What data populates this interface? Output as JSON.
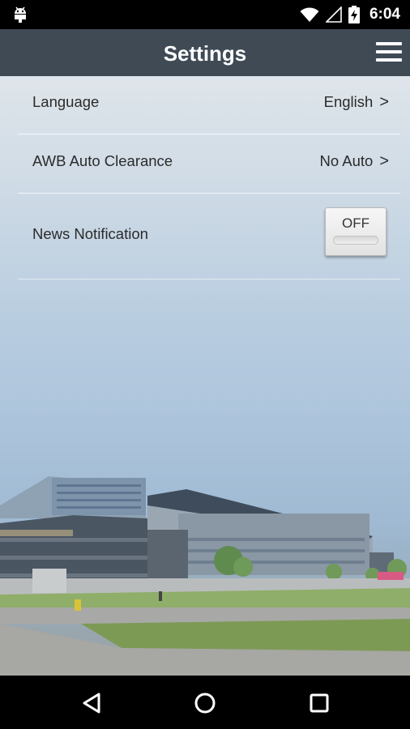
{
  "status_bar": {
    "time": "6:04",
    "icons": [
      "android-icon",
      "wifi-icon",
      "cellular-signal-icon",
      "battery-charging-icon"
    ]
  },
  "header": {
    "title": "Settings",
    "menu_icon": "hamburger-menu-icon",
    "background_color": "#3f4a55"
  },
  "settings": {
    "language": {
      "label": "Language",
      "value": "English",
      "chevron": ">"
    },
    "awb_auto_clearance": {
      "label": "AWB Auto Clearance",
      "value": "No Auto",
      "chevron": ">"
    },
    "news_notification": {
      "label": "News Notification",
      "toggle_label": "OFF"
    }
  },
  "nav_bar": {
    "icons": [
      "back-icon",
      "home-icon",
      "recent-apps-icon"
    ]
  }
}
